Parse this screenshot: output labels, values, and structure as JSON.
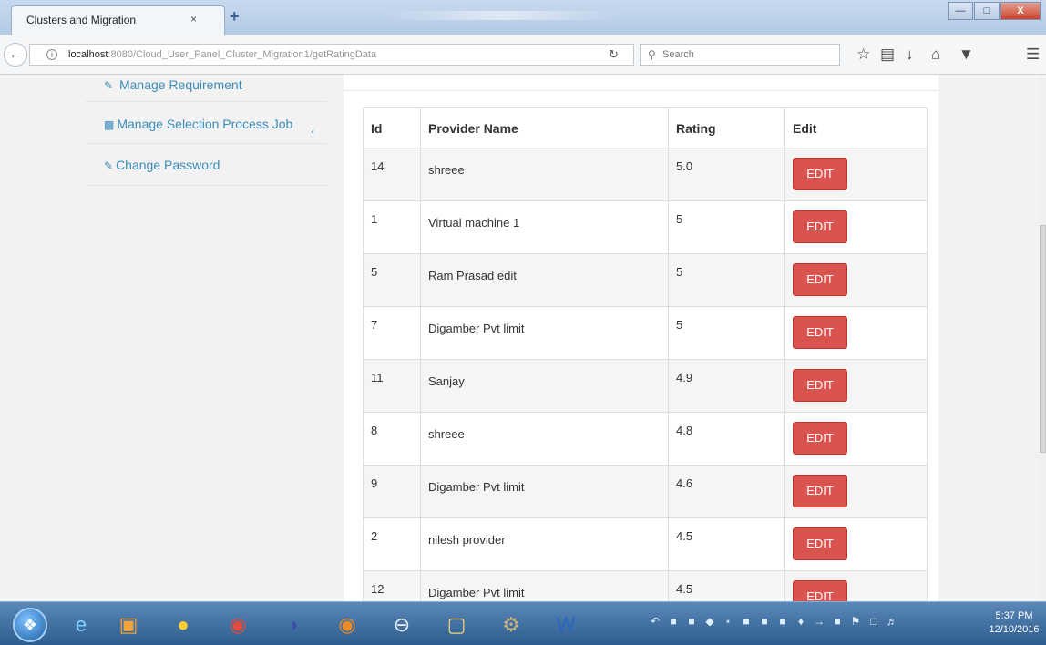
{
  "browser": {
    "tab_title": "Clusters and Migration",
    "tab_close": "×",
    "new_tab": "+",
    "url_host": "localhost",
    "url_rest": ":8080/Cloud_User_Panel_Cluster_Migration1/getRatingData",
    "search_placeholder": "Search",
    "window_buttons": {
      "minimize": "—",
      "maximize": "□",
      "close": "X"
    }
  },
  "sidebar": {
    "items": [
      {
        "icon": "edit-icon",
        "label": "Manage Requirement"
      },
      {
        "icon": "bar-chart-icon",
        "label": "Manage Selection Process Job"
      },
      {
        "icon": "edit-icon",
        "label": "Change Password"
      }
    ]
  },
  "table": {
    "headers": [
      "Id",
      "Provider Name",
      "Rating",
      "Edit"
    ],
    "rows": [
      {
        "id": "14",
        "name": "shreee",
        "rating": "5.0",
        "edit": "EDIT"
      },
      {
        "id": "1",
        "name": "Virtual machine 1",
        "rating": "5",
        "edit": "EDIT"
      },
      {
        "id": "5",
        "name": "Ram Prasad edit",
        "rating": "5",
        "edit": "EDIT"
      },
      {
        "id": "7",
        "name": "Digamber Pvt limit",
        "rating": "5",
        "edit": "EDIT"
      },
      {
        "id": "11",
        "name": "Sanjay",
        "rating": "4.9",
        "edit": "EDIT"
      },
      {
        "id": "8",
        "name": "shreee",
        "rating": "4.8",
        "edit": "EDIT"
      },
      {
        "id": "9",
        "name": "Digamber Pvt limit",
        "rating": "4.6",
        "edit": "EDIT"
      },
      {
        "id": "2",
        "name": "nilesh provider",
        "rating": "4.5",
        "edit": "EDIT"
      },
      {
        "id": "12",
        "name": "Digamber Pvt limit",
        "rating": "4.5",
        "edit": "EDIT"
      }
    ]
  },
  "taskbar": {
    "time": "5:37 PM",
    "date": "12/10/2016",
    "apps": [
      "ie-icon",
      "media-player-icon",
      "sun-app-icon",
      "chrome-icon",
      "eclipse-icon",
      "firefox-icon",
      "minus-app-icon",
      "folder-icon",
      "settings-app-icon",
      "word-icon"
    ]
  },
  "colors": {
    "accent": "#3c8dbc",
    "danger": "#d9534f"
  }
}
